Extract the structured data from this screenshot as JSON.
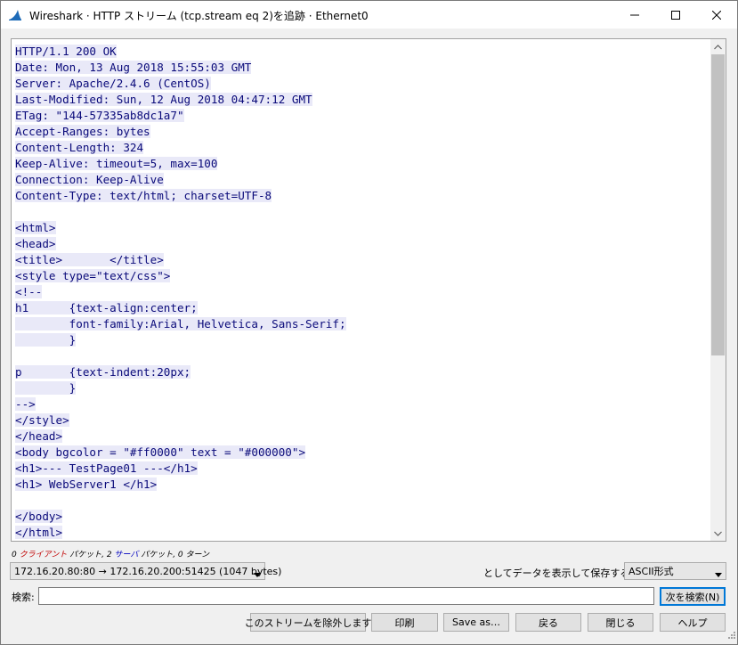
{
  "window": {
    "title": "Wireshark · HTTP ストリーム (tcp.stream eq 2)を追跡 · Ethernet0",
    "icon": "wireshark-fin-icon"
  },
  "stream_lines": [
    "HTTP/1.1 200 OK",
    "Date: Mon, 13 Aug 2018 15:55:03 GMT",
    "Server: Apache/2.4.6 (CentOS)",
    "Last-Modified: Sun, 12 Aug 2018 04:47:12 GMT",
    "ETag: \"144-57335ab8dc1a7\"",
    "Accept-Ranges: bytes",
    "Content-Length: 324",
    "Keep-Alive: timeout=5, max=100",
    "Connection: Keep-Alive",
    "Content-Type: text/html; charset=UTF-8",
    "",
    "<html>",
    "<head>",
    "<title>       </title>",
    "<style type=\"text/css\">",
    "<!--",
    "h1      {text-align:center;",
    "        font-family:Arial, Helvetica, Sans-Serif;",
    "        }",
    "",
    "p       {text-indent:20px;",
    "        }",
    "-->",
    "</style>",
    "</head>",
    "<body bgcolor = \"#ff0000\" text = \"#000000\">",
    "<h1>--- TestPage01 ---</h1>",
    "<h1> WebServer1 </h1>",
    "",
    "</body>",
    "</html>"
  ],
  "stats": {
    "prefix": "0 ",
    "client": "クライアント",
    "mid": " パケット, 2 ",
    "server": "サーバ",
    "suffix": " パケット, 0 ターン"
  },
  "conversation_select": "172.16.20.80:80 → 172.16.20.200:51425 (1047 bytes)",
  "show_as_label": "としてデータを表示して保存する",
  "show_as_select": "ASCII形式",
  "find": {
    "label": "検索:",
    "value": "",
    "next_button": "次を検索(N)"
  },
  "buttons": {
    "filter_out": "このストリームを除外します",
    "print": "印刷",
    "save_as": "Save as…",
    "back": "戻る",
    "close": "閉じる",
    "help": "ヘルプ"
  },
  "colors": {
    "stream_text": "#0a0a7a",
    "stream_highlight": "#e9e9f8",
    "client_text": "#c00000",
    "server_text": "#0000c0"
  }
}
